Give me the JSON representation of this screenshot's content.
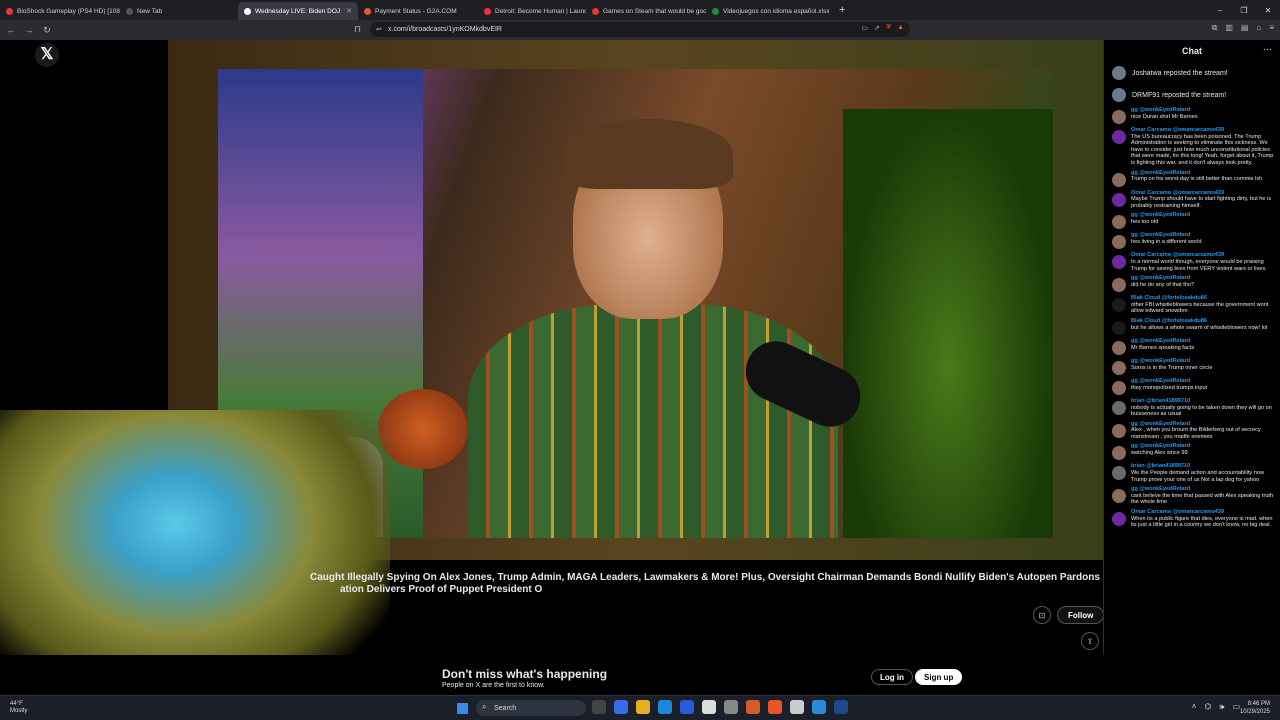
{
  "browser": {
    "tabs": [
      {
        "label": "BioShock Gameplay (PS4 HD) [1080p...",
        "color": "#e33"
      },
      {
        "label": "New Tab",
        "color": "#555"
      },
      {
        "label": "Wednesday LIVE: Biden DOJ",
        "color": "#fff",
        "active": true
      },
      {
        "label": "Payment Status - G2A.COM",
        "color": "#e85a20"
      },
      {
        "label": "Detroit: Become Human | Launch Tr...",
        "color": "#e33"
      },
      {
        "label": "Games on Steam that would be goo...",
        "color": "#e33"
      },
      {
        "label": "Videojuegos con idioma español.xlsx",
        "color": "#1e8e3e"
      }
    ],
    "new_tab_label": "+",
    "url": "x.com/i/broadcasts/1ynKOMkdbvEIR"
  },
  "x_logo": "𝕏",
  "broadcast": {
    "title_line1": "Caught Illegally Spying On Alex Jones, Trump Admin, MAGA Leaders, Lawmakers & More! Plus, Oversight Chairman Demands Bondi Nullify Biden's Autopen Pardons",
    "title_line2": "ation Delivers Proof of Puppet President O",
    "follow_label": "Follow"
  },
  "chat": {
    "title": "Chat",
    "reposts": [
      {
        "text": "Joshatwa reposted the stream!"
      },
      {
        "text": "DRMF91 reposted the stream!"
      }
    ],
    "messages": [
      {
        "name": "gg @wonkEyedRetard",
        "text": "nice Duran shirt Mr Barnes",
        "color": "#8a6a5a"
      },
      {
        "name": "Omar Carcamo @omarcarcamo439",
        "text": "The US bureaucracy has been poisoned. The Trump Administration is seeking to eliminate this sickness. We have to consider just how much unconstitutional policies that were made, for this long! Yeah, forget about it, Trump is fighting this war, and it don't always look pretty.",
        "color": "#6a2aa0"
      },
      {
        "name": "gg @wonkEyedRetard",
        "text": "Trump on his worst day is still better than commie lsh",
        "color": "#8a6a5a"
      },
      {
        "name": "Omar Carcamo @omarcarcamo439",
        "text": "Maybe Trump should have to start fighting dirty, but he is probably restraining himself.",
        "color": "#6a2aa0"
      },
      {
        "name": "gg @wonkEyedRetard",
        "text": "hes too old",
        "color": "#8a6a5a"
      },
      {
        "name": "gg @wonkEyedRetard",
        "text": "hes living in a different world",
        "color": "#8a6a5a"
      },
      {
        "name": "Omar Carcamo @omarcarcamo439",
        "text": "In a normal world though, everyone would be praising Trump for saving lives from VERY violent wars or lives.",
        "color": "#6a2aa0"
      },
      {
        "name": "gg @wonkEyedRetard",
        "text": "did he do any of that tho?",
        "color": "#8a6a5a"
      },
      {
        "name": "Blak Cloud @fortelosakdu86",
        "text": "other FBI whistleblowers because the government wont allow edward snowden",
        "color": "#1a1a1a"
      },
      {
        "name": "Blak Cloud @fortelosakdu86",
        "text": "but he allows a whole swarm of whistleblowers now! lol",
        "color": "#1a1a1a"
      },
      {
        "name": "gg @wonkEyedRetard",
        "text": "Mr Barnes speaking facts",
        "color": "#8a6a5a"
      },
      {
        "name": "gg @wonkEyedRetard",
        "text": "Soros is in the Trump inner circle",
        "color": "#8a6a5a"
      },
      {
        "name": "gg @wonkEyedRetard",
        "text": "they monopolized trumps input",
        "color": "#8a6a5a"
      },
      {
        "name": "brian @brian41899710",
        "text": "nobody is actually going to be taken down they will go on buisseness as usual",
        "color": "#6a6a6a"
      },
      {
        "name": "gg @wonkEyedRetard",
        "text": "Alex , when you brount the Bilderberg out of secrecy manstream , you madfe enemies",
        "color": "#8a6a5a"
      },
      {
        "name": "gg @wonkEyedRetard",
        "text": "watching Alex since 99",
        "color": "#8a6a5a"
      },
      {
        "name": "brian @brian41899710",
        "text": "We the People demand action and accountability now Trump prove your one of us Not a lap dog for yahoo",
        "color": "#6a6a6a"
      },
      {
        "name": "gg @wonkEyedRetard",
        "text": "cant believe the time that passed with Alex speaking truth the whole time",
        "color": "#8a6a5a"
      },
      {
        "name": "Omar Carcamo @omarcarcamo439",
        "text": "When its a public figure that dies, everyone is mad. when its just a little girl in a country we don't know, no big deal.",
        "color": "#6a2aa0"
      }
    ]
  },
  "banner": {
    "headline": "Don't miss what's happening",
    "sub": "People on X are the first to know.",
    "login": "Log in",
    "signup": "Sign up"
  },
  "taskbar": {
    "weather_temp": "44°F",
    "weather_desc": "Mostly",
    "search_placeholder": "Search",
    "time": "8:46 PM",
    "date": "10/29/2025"
  }
}
